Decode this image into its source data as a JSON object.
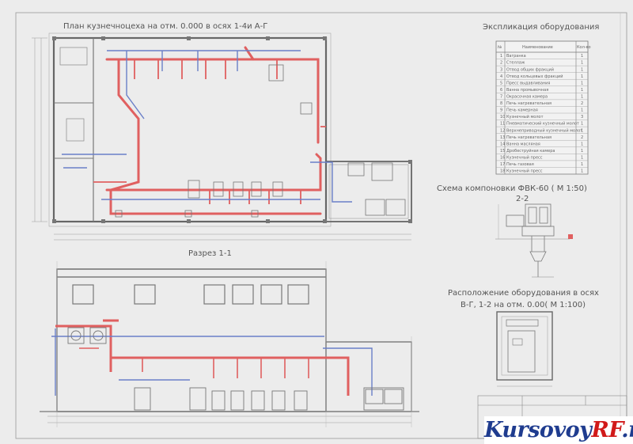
{
  "drawing": {
    "plan_title": "План кузнечноцеха на отм. 0.000 в осях 1-4и А-Г",
    "section_title": "Разрез 1-1",
    "fvk_title": "Схема компоновки ФВК-60 ( М 1:50)",
    "fvk_section": "2-2",
    "layout_title_line1": "Расположение оборудования в осях",
    "layout_title_line2": "В-Г, 1-2 на отм. 0.00( М 1:100)"
  },
  "explication": {
    "title": "Экспликация оборудования",
    "headers": [
      "№",
      "Наименование",
      "Кол-во"
    ],
    "rows": [
      [
        "1",
        "Вагранка",
        "1"
      ],
      [
        "2",
        "Стеллаж",
        "1"
      ],
      [
        "3",
        "Отвод общих фракций",
        "1"
      ],
      [
        "4",
        "Отвод кольцевых фракций",
        "1"
      ],
      [
        "5",
        "Пресс выдавливания",
        "1"
      ],
      [
        "6",
        "Ванна промывочная",
        "1"
      ],
      [
        "7",
        "Окрасочная камера",
        "1"
      ],
      [
        "8",
        "Печь нагревательная",
        "2"
      ],
      [
        "9",
        "Печь камерная",
        "1"
      ],
      [
        "10",
        "Кузнечный молот",
        "3"
      ],
      [
        "11",
        "Пневматический кузнечный молот",
        "1"
      ],
      [
        "12",
        "Верхнеприводный кузнечный молот",
        "1"
      ],
      [
        "13",
        "Печь нагревательная",
        "2"
      ],
      [
        "14",
        "Ванна масляная",
        "1"
      ],
      [
        "15",
        "Дробеструйная камера",
        "1"
      ],
      [
        "16",
        "Кузнечный пресс",
        "1"
      ],
      [
        "17",
        "Печь газовая",
        "1"
      ],
      [
        "18",
        "Кузнечный пресс",
        "1"
      ]
    ]
  },
  "watermark": {
    "part1": "Kursovoy",
    "part2": "RF",
    "part3": ".ru"
  }
}
